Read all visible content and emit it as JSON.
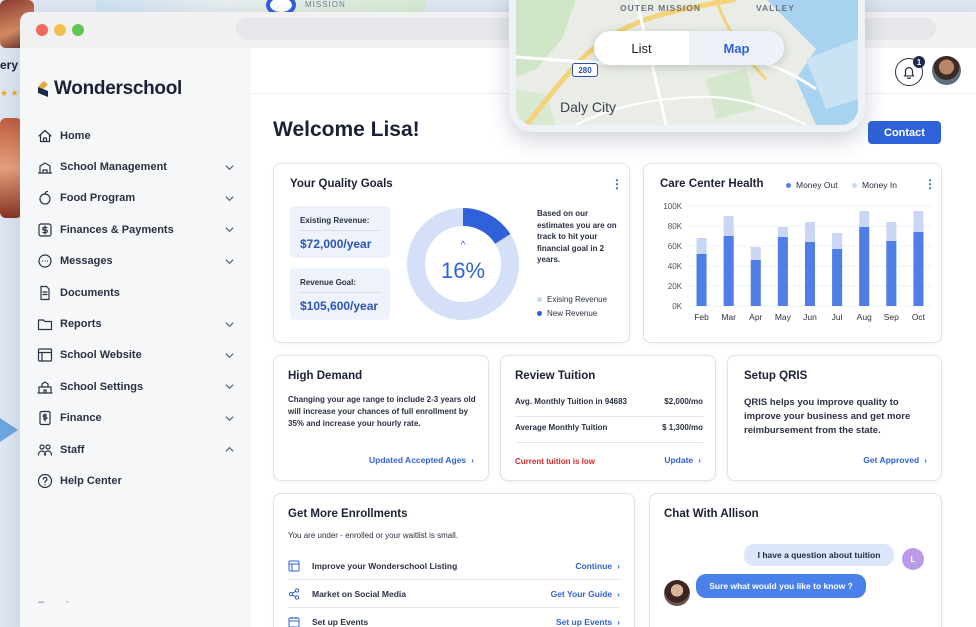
{
  "background": {
    "partial_text": "ery",
    "stars": "★ ★",
    "map_text": "MISSION"
  },
  "brand": {
    "name": "Wonderschool"
  },
  "nav": {
    "items": [
      {
        "label": "Home",
        "icon": "home-icon",
        "expand": ""
      },
      {
        "label": "School Management",
        "icon": "building-icon",
        "expand": "down"
      },
      {
        "label": "Food Program",
        "icon": "apple-icon",
        "expand": "down"
      },
      {
        "label": "Finances & Payments",
        "icon": "dollar-icon",
        "expand": "down"
      },
      {
        "label": "Messages",
        "icon": "chat-icon",
        "expand": "down"
      },
      {
        "label": "Documents",
        "icon": "document-icon",
        "expand": ""
      },
      {
        "label": "Reports",
        "icon": "folder-icon",
        "expand": "down"
      },
      {
        "label": "School Website",
        "icon": "browser-icon",
        "expand": "down"
      },
      {
        "label": "School Settings",
        "icon": "school-icon",
        "expand": "down"
      },
      {
        "label": "Finance",
        "icon": "finance-icon",
        "expand": "down"
      },
      {
        "label": "Staff",
        "icon": "staff-icon",
        "expand": "up"
      },
      {
        "label": "Help Center",
        "icon": "help-icon",
        "expand": ""
      }
    ]
  },
  "header": {
    "notification_count": "1"
  },
  "page": {
    "title": "Welcome Lisa!",
    "contact_label": "Contact"
  },
  "quality_goals": {
    "title": "Your Quality Goals",
    "existing_label": "Existing Revenue:",
    "existing_value": "$72,000/year",
    "goal_label": "Revenue Goal:",
    "goal_value": "$105,600/year",
    "percent_text": "16%",
    "progress_fraction": 0.16,
    "note": "Based on our estimates you are on track to hit your financial goal in 2 years.",
    "legend_existing": "Exising Revenue",
    "legend_new": "New Revenue",
    "colors": {
      "existing": "#d4e0f8",
      "new": "#2f62d8"
    }
  },
  "care_center": {
    "title": "Care Center Health",
    "legend_out": "Money Out",
    "legend_in": "Money In"
  },
  "chart_data": {
    "type": "bar",
    "title": "Care Center Health",
    "categories": [
      "Feb",
      "Mar",
      "Apr",
      "May",
      "Jun",
      "Jul",
      "Aug",
      "Sep",
      "Oct"
    ],
    "series": [
      {
        "name": "Money Out",
        "color": "#4f7fe6",
        "values": [
          52000,
          70000,
          46000,
          69000,
          64000,
          57000,
          79000,
          65000,
          74000
        ]
      },
      {
        "name": "Money In",
        "color": "#c9d6f4",
        "values": [
          68000,
          90000,
          59000,
          79000,
          84000,
          73000,
          95000,
          84000,
          95000
        ]
      }
    ],
    "y_ticks": [
      "0K",
      "20K",
      "40K",
      "60K",
      "80K",
      "100K"
    ],
    "ylim": [
      0,
      100000
    ],
    "grid": true,
    "legend": "top"
  },
  "high_demand": {
    "title": "High Demand",
    "text": "Changing your age range to include 2-3 years old will increase your chances of full enrollment by 35% and increase your hourly rate.",
    "link": "Updated Accepted Ages"
  },
  "review_tuition": {
    "title": "Review Tuition",
    "row1_label": "Avg. Monthly Tuition in 94683",
    "row1_value": "$2,000/mo",
    "row2_label": "Average Monthly Tuition",
    "row2_value": "$ 1,300/mo",
    "alert": "Current tuition is low",
    "link": "Update"
  },
  "qris": {
    "title": "Setup QRIS",
    "text": "QRIS helps you improve quality to improve your business and get more reimbursement from the state.",
    "link": "Get Approved"
  },
  "enrollments": {
    "title": "Get More Enrollments",
    "subtitle": "You are under - enrolled or your waitlist is small.",
    "rows": [
      {
        "label": "Improve your Wonderschool Listing",
        "action": "Continue",
        "icon": "layout-icon"
      },
      {
        "label": "Market on Social Media",
        "action": "Get Your Guide",
        "icon": "share-icon"
      },
      {
        "label": "Set up Events",
        "action": "Set up Events",
        "icon": "calendar-icon"
      }
    ]
  },
  "chat": {
    "title": "Chat With Allison",
    "user_message": "I have a question about tuition",
    "user_initial": "L",
    "reply": "Sure what would you like to know ?"
  },
  "map": {
    "top_left_label": "OUTER MISSION",
    "top_right_label": "VALLEY",
    "city": "Daly City",
    "highway": "280",
    "toggle_list": "List",
    "toggle_map": "Map",
    "selected": "Map"
  }
}
